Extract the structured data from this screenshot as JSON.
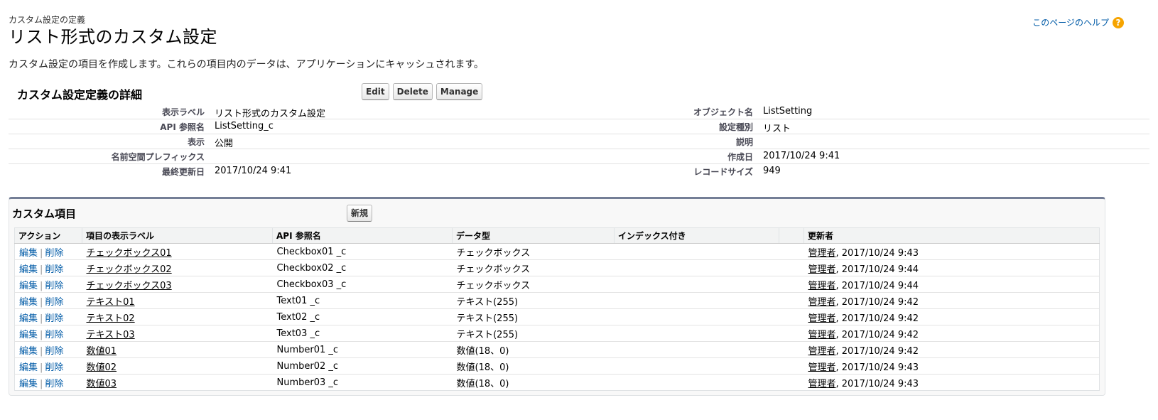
{
  "header": {
    "breadcrumb": "カスタム設定の定義",
    "title": "リスト形式のカスタム設定",
    "help_link": "このページのヘルプ",
    "help_icon": "question-circle-icon",
    "description": "カスタム設定の項目を作成します。これらの項目内のデータは、アプリケーションにキャッシュされます。"
  },
  "detail": {
    "title": "カスタム設定定義の詳細",
    "buttons": {
      "edit": "Edit",
      "delete": "Delete",
      "manage": "Manage"
    },
    "rows": [
      {
        "label1": "表示ラベル",
        "value1": "リスト形式のカスタム設定",
        "label2": "オブジェクト名",
        "value2": "ListSetting"
      },
      {
        "label1": "API 参照名",
        "value1": "ListSetting_c",
        "label2": "設定種別",
        "value2": "リスト"
      },
      {
        "label1": "表示",
        "value1": "公開",
        "label2": "説明",
        "value2": ""
      },
      {
        "label1": "名前空間プレフィックス",
        "value1": "",
        "label2": "作成日",
        "value2": "2017/10/24 9:41"
      },
      {
        "label1": "最終更新日",
        "value1": "2017/10/24 9:41",
        "label2": "レコードサイズ",
        "value2": "949"
      }
    ]
  },
  "fields": {
    "title": "カスタム項目",
    "new_button": "新規",
    "columns": [
      "アクション",
      "項目の表示ラベル",
      "API 参照名",
      "データ型",
      "インデックス付き",
      "",
      "更新者"
    ],
    "action_edit": "編集",
    "action_sep": "|",
    "action_delete": "削除",
    "rows": [
      {
        "label": "チェックボックス01",
        "api": "Checkbox01 _c",
        "type": "チェックボックス",
        "indexed": "",
        "user": "管理者",
        "date": ", 2017/10/24 9:43"
      },
      {
        "label": "チェックボックス02",
        "api": "Checkbox02 _c",
        "type": "チェックボックス",
        "indexed": "",
        "user": "管理者",
        "date": ", 2017/10/24 9:44"
      },
      {
        "label": "チェックボックス03",
        "api": "Checkbox03 _c",
        "type": "チェックボックス",
        "indexed": "",
        "user": "管理者",
        "date": ", 2017/10/24 9:44"
      },
      {
        "label": "テキスト01",
        "api": "Text01 _c",
        "type": "テキスト(255)",
        "indexed": "",
        "user": "管理者",
        "date": ", 2017/10/24 9:42"
      },
      {
        "label": "テキスト02",
        "api": "Text02 _c",
        "type": "テキスト(255)",
        "indexed": "",
        "user": "管理者",
        "date": ", 2017/10/24 9:42"
      },
      {
        "label": "テキスト03",
        "api": "Text03 _c",
        "type": "テキスト(255)",
        "indexed": "",
        "user": "管理者",
        "date": ", 2017/10/24 9:42"
      },
      {
        "label": "数値01",
        "api": "Number01 _c",
        "type": "数値(18、0)",
        "indexed": "",
        "user": "管理者",
        "date": ", 2017/10/24 9:42"
      },
      {
        "label": "数値02",
        "api": "Number02 _c",
        "type": "数値(18、0)",
        "indexed": "",
        "user": "管理者",
        "date": ", 2017/10/24 9:43"
      },
      {
        "label": "数値03",
        "api": "Number03 _c",
        "type": "数値(18、0)",
        "indexed": "",
        "user": "管理者",
        "date": ", 2017/10/24 9:43"
      }
    ]
  }
}
